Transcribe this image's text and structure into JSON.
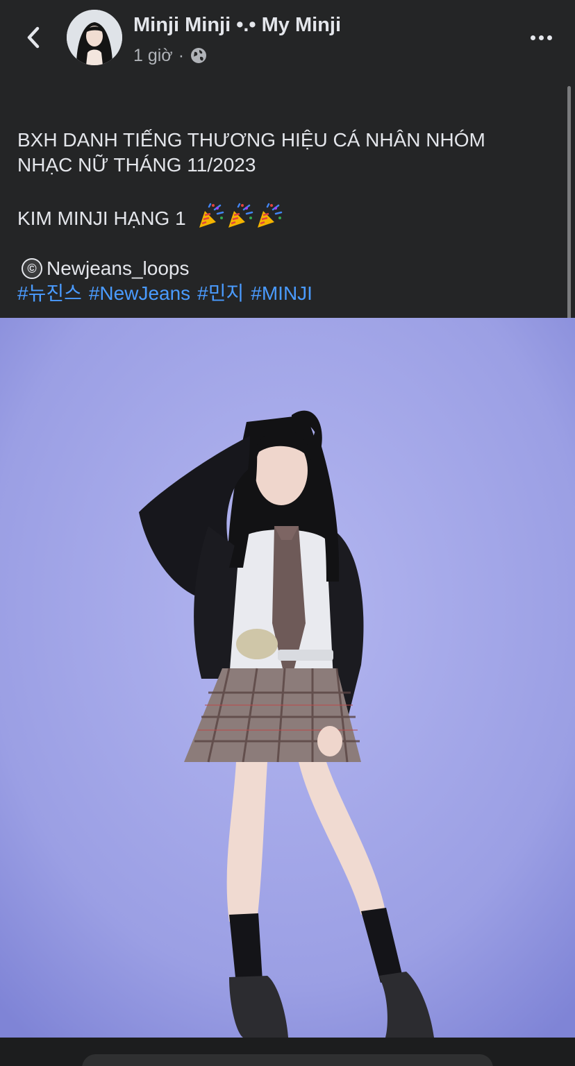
{
  "header": {
    "author": "Minji Minji •.• My Minji",
    "time": "1 giờ",
    "separator": "·",
    "privacy_icon": "globe-icon",
    "back_icon": "chevron-left-icon",
    "more_icon": "more-horizontal-icon"
  },
  "post": {
    "line1": "BXH DANH TIẾNG THƯƠNG HIỆU CÁ NHÂN NHÓM",
    "line2": "NHẠC NỮ THÁNG 11/2023",
    "line3": "KIM MINJI HẠNG 1",
    "emoji_icon": "party-popper-icon",
    "credit_symbol": "©",
    "credit": "Newjeans_loops",
    "hashtags": [
      "#뉴진스",
      "#NewJeans",
      "#민지",
      "#MINJI"
    ]
  },
  "colors": {
    "background": "#242526",
    "text": "#e4e6eb",
    "muted": "#b0b3b8",
    "link": "#4a9bff",
    "photo_backdrop": "#9da2e6"
  }
}
